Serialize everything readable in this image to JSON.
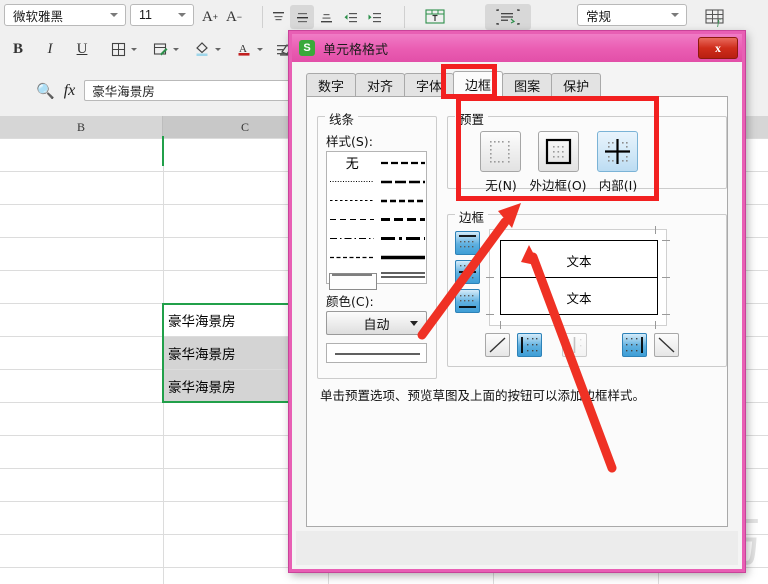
{
  "toolbar": {
    "font_name": "微软雅黑",
    "font_size": "11",
    "grow_font": "A",
    "shrink_font": "A",
    "bold": "B",
    "italic": "I",
    "underline": "U",
    "border_icon": "borders-icon",
    "fill_icon": "fill-color-icon",
    "font_color": "A",
    "eraser_icon": "clear-format-icon",
    "number_format": "常规",
    "align_top_icon": "align-top-icon",
    "align_middle_icon": "align-middle-icon",
    "align_bottom_icon": "align-bottom-icon",
    "indent_dec_icon": "decrease-indent-icon",
    "indent_inc_icon": "increase-indent-icon",
    "merge_icon": "merge-cells-icon",
    "wrap_icon": "wrap-text-icon",
    "table_icon": "format-table-icon"
  },
  "formula_bar": {
    "search_icon": "search-icon",
    "fx_label": "fx",
    "value": "豪华海景房"
  },
  "sheet": {
    "columns": [
      {
        "label": "B",
        "selected": false
      },
      {
        "label": "C",
        "selected": true
      }
    ],
    "cells": [
      "豪华海景房",
      "豪华海景房",
      "豪华海景房"
    ],
    "watermark": "软件技巧"
  },
  "dialog": {
    "logo": "S",
    "title": "单元格格式",
    "close_label": "x",
    "tabs": [
      {
        "label": "数字",
        "selected": false
      },
      {
        "label": "对齐",
        "selected": false
      },
      {
        "label": "字体",
        "selected": false
      },
      {
        "label": "边框",
        "selected": true
      },
      {
        "label": "图案",
        "selected": false
      },
      {
        "label": "保护",
        "selected": false
      }
    ],
    "line_group": {
      "title": "线条",
      "style_label": "样式(S):",
      "none_label": "无",
      "color_label": "颜色(C):",
      "color_value": "自动"
    },
    "preset_group": {
      "title": "预置",
      "buttons": [
        {
          "label": "无(N)",
          "name": "preset-none",
          "active": false
        },
        {
          "label": "外边框(O)",
          "name": "preset-outline",
          "active": false
        },
        {
          "label": "内部(I)",
          "name": "preset-inside",
          "active": true
        }
      ]
    },
    "border_group": {
      "title": "边框",
      "preview_text_top": "文本",
      "preview_text_bottom": "文本",
      "side_buttons": [
        {
          "name": "border-top-button",
          "active": true
        },
        {
          "name": "border-horizontal-button",
          "active": true
        },
        {
          "name": "border-bottom-button",
          "active": true
        }
      ],
      "bottom_buttons": [
        {
          "name": "border-diagonal-up-button",
          "active": false
        },
        {
          "name": "border-left-button",
          "active": true
        },
        {
          "name": "border-vertical-button",
          "active": false
        },
        {
          "name": "border-right-button",
          "active": true
        },
        {
          "name": "border-diagonal-down-button",
          "active": false
        }
      ],
      "hint": "单击预置选项、预览草图及上面的按钮可以添加边框样式。"
    }
  },
  "annotations": {
    "highlight_color": "#f22020"
  }
}
